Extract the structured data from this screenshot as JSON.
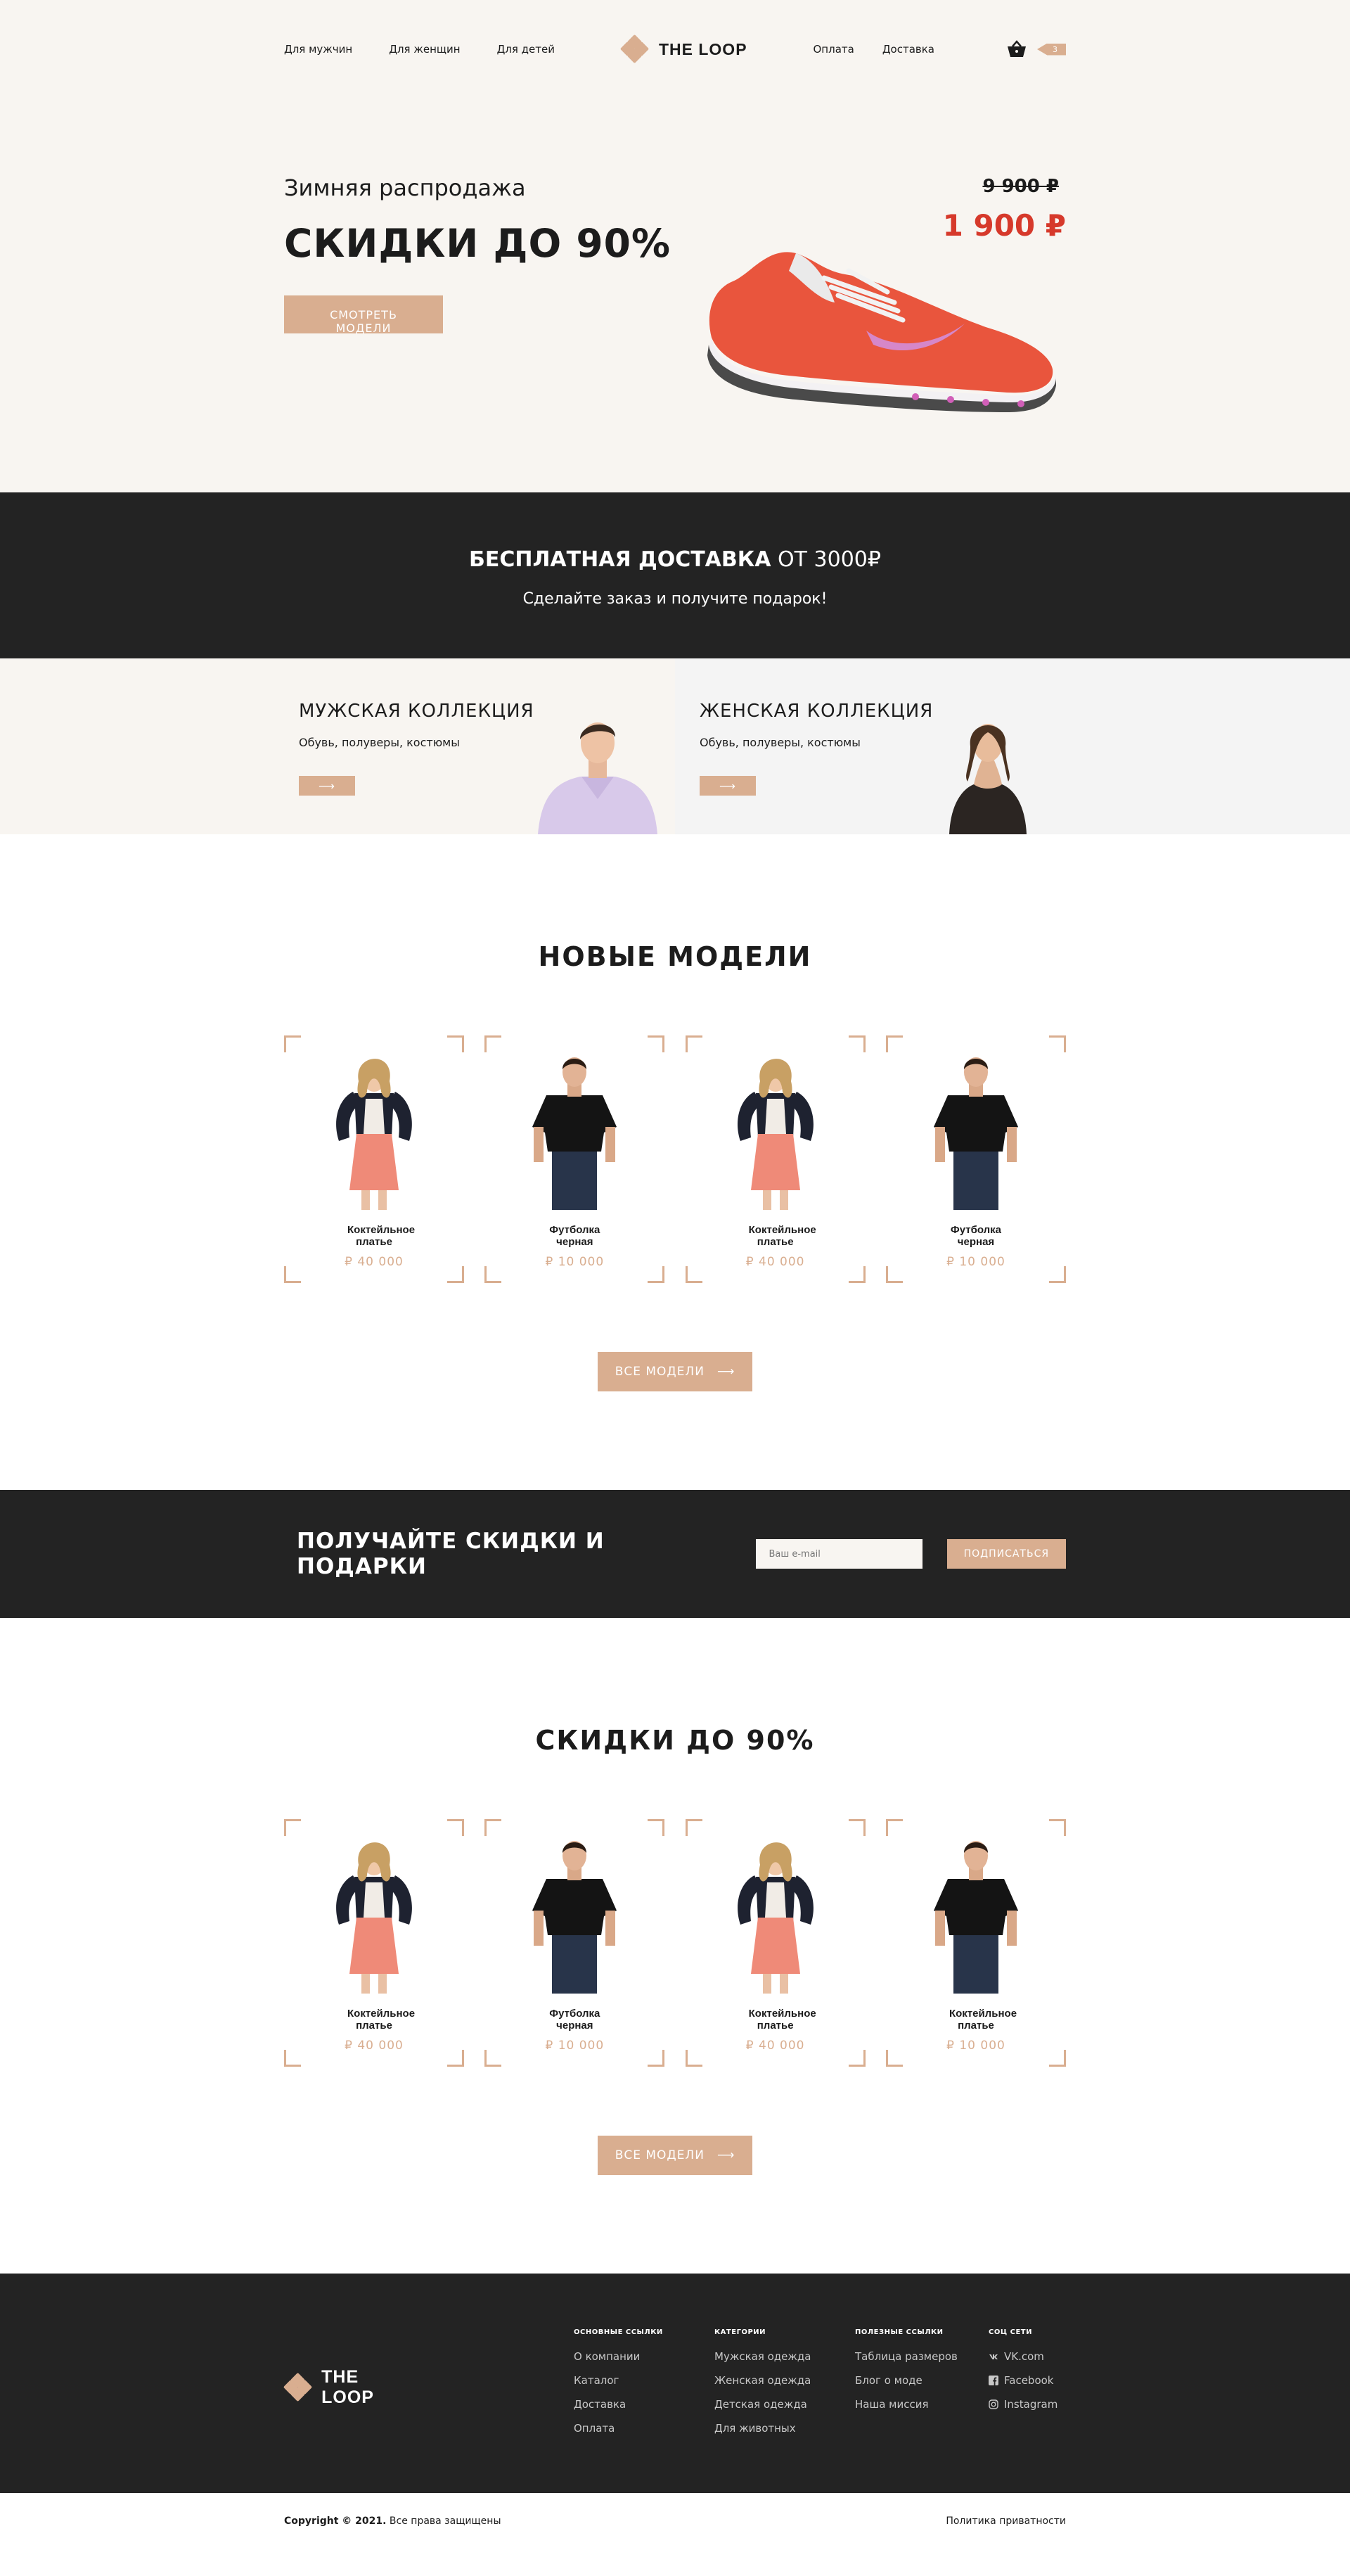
{
  "header": {
    "nav_left": [
      "Для мужчин",
      "Для женщин",
      "Для детей"
    ],
    "brand": "THE LOOP",
    "nav_right": [
      "Оплата",
      "Доставка"
    ],
    "cart_count": "3"
  },
  "hero": {
    "subtitle": "Зимняя распродажа",
    "title": "СКИДКИ ДО 90%",
    "button": "СМОТРЕТЬ МОДЕЛИ",
    "price_old": "9 900 ₽",
    "price_new": "1 900 ₽"
  },
  "delivery": {
    "title_bold": "БЕСПЛАТНАЯ ДОСТАВКА",
    "title_rest": " ОТ 3000₽",
    "subtitle": "Сделайте заказ и получите подарок!"
  },
  "collections": {
    "men": {
      "title": "МУЖСКАЯ КОЛЛЕКЦИЯ",
      "desc": "Обувь, полуверы, костюмы"
    },
    "women": {
      "title": "ЖЕНСКАЯ КОЛЛЕКЦИЯ",
      "desc": "Обувь, полуверы, костюмы"
    }
  },
  "new_models": {
    "title": "НОВЫЕ МОДЕЛИ",
    "items": [
      {
        "name": "Коктейльное платье",
        "price": "₽ 40 000"
      },
      {
        "name": "Футболка черная",
        "price": "₽ 10 000"
      },
      {
        "name": "Коктейльное платье",
        "price": "₽ 40 000"
      },
      {
        "name": "Футболка черная",
        "price": "₽ 10 000"
      }
    ],
    "button": "ВСЕ МОДЕЛИ"
  },
  "subscribe": {
    "title": "ПОЛУЧАЙТЕ СКИДКИ И ПОДАРКИ",
    "placeholder": "Ваш e-mail",
    "button": "ПОДПИСАТЬСЯ"
  },
  "sale": {
    "title": "СКИДКИ ДО 90%",
    "items": [
      {
        "name": "Коктейльное платье",
        "price": "₽ 40 000"
      },
      {
        "name": "Футболка черная",
        "price": "₽ 10 000"
      },
      {
        "name": "Коктейльное платье",
        "price": "₽ 40 000"
      },
      {
        "name": "Коктейльное платье",
        "price": "₽ 10 000"
      }
    ],
    "button": "ВСЕ МОДЕЛИ"
  },
  "footer": {
    "brand": "THE LOOP",
    "col1": {
      "title": "ОСНОВНЫЕ ССЫЛКИ",
      "links": [
        "О компании",
        "Каталог",
        "Доставка",
        "Оплата"
      ]
    },
    "col2": {
      "title": "КАТЕГОРИИ",
      "links": [
        "Мужская одежда",
        "Женская одежда",
        "Детская одежда",
        "Для животных"
      ]
    },
    "col3": {
      "title": "ПОЛЕЗНЫЕ ССЫЛКИ",
      "links": [
        "Таблица размеров",
        "Блог о моде",
        "Наша миссия"
      ]
    },
    "col4": {
      "title": "СОЦ СЕТИ",
      "links": [
        "VK.com",
        "Facebook",
        "Instagram"
      ]
    }
  },
  "bottom": {
    "copyright_bold": "Copyright © 2021.",
    "copyright_rest": " Все права защищены",
    "privacy": "Политика приватности"
  },
  "colors": {
    "accent": "#d9ae90",
    "dark": "#232323",
    "cream": "#f8f5f1",
    "sale_red": "#d6392b"
  }
}
